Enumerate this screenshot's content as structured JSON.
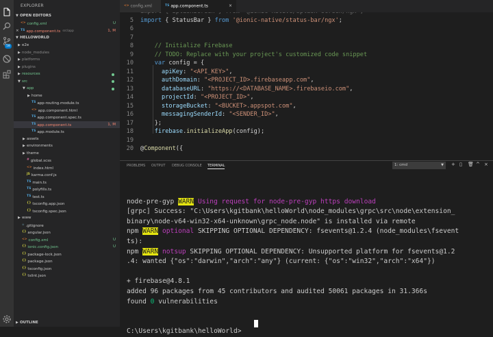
{
  "sidebar": {
    "title": "EXPLORER",
    "open_editors_header": "OPEN EDITORS",
    "open_editors": [
      {
        "name": "config.xml",
        "badge": "U",
        "close": ""
      },
      {
        "name": "app.component.ts",
        "path": "src\\app",
        "badge": "1, M",
        "close": "×"
      }
    ],
    "project_header": "HELLOWORLD",
    "outline_header": "OUTLINE",
    "tree": [
      {
        "label": "e2e",
        "type": "folder",
        "open": false,
        "badge": ""
      },
      {
        "label": "node_modules",
        "type": "folder",
        "open": false,
        "badge": ""
      },
      {
        "label": "platforms",
        "type": "folder",
        "open": false,
        "badge": ""
      },
      {
        "label": "plugins",
        "type": "folder",
        "open": false,
        "badge": ""
      },
      {
        "label": "resources",
        "type": "folder",
        "open": false,
        "badge": "dot"
      },
      {
        "label": "src",
        "type": "folder",
        "open": true,
        "badge": "dot"
      },
      {
        "label": "app",
        "type": "folder",
        "open": true,
        "badge": "dot"
      },
      {
        "label": "home",
        "type": "folder",
        "open": false,
        "badge": ""
      },
      {
        "label": "app-routing.module.ts",
        "type": "ts",
        "badge": ""
      },
      {
        "label": "app.component.html",
        "type": "html",
        "badge": ""
      },
      {
        "label": "app.component.spec.ts",
        "type": "ts",
        "badge": ""
      },
      {
        "label": "app.component.ts",
        "type": "ts",
        "badge": "1, M"
      },
      {
        "label": "app.module.ts",
        "type": "ts",
        "badge": ""
      },
      {
        "label": "assets",
        "type": "folder",
        "open": false,
        "badge": ""
      },
      {
        "label": "environments",
        "type": "folder",
        "open": false,
        "badge": ""
      },
      {
        "label": "theme",
        "type": "folder",
        "open": false,
        "badge": ""
      },
      {
        "label": "global.scss",
        "type": "css",
        "badge": ""
      },
      {
        "label": "index.html",
        "type": "html",
        "badge": ""
      },
      {
        "label": "karma.conf.js",
        "type": "js",
        "badge": ""
      },
      {
        "label": "main.ts",
        "type": "ts",
        "badge": ""
      },
      {
        "label": "polyfills.ts",
        "type": "ts",
        "badge": ""
      },
      {
        "label": "test.ts",
        "type": "ts",
        "badge": ""
      },
      {
        "label": "tsconfig.app.json",
        "type": "json",
        "badge": ""
      },
      {
        "label": "tsconfig.spec.json",
        "type": "json",
        "badge": ""
      },
      {
        "label": "www",
        "type": "folder",
        "open": false,
        "badge": ""
      },
      {
        "label": ".gitignore",
        "type": "git",
        "badge": ""
      },
      {
        "label": "angular.json",
        "type": "json",
        "badge": ""
      },
      {
        "label": "config.xml",
        "type": "xml",
        "badge": "U"
      },
      {
        "label": "ionic.config.json",
        "type": "json",
        "badge": "U"
      },
      {
        "label": "package-lock.json",
        "type": "json",
        "badge": ""
      },
      {
        "label": "package.json",
        "type": "json",
        "badge": ""
      },
      {
        "label": "tsconfig.json",
        "type": "json",
        "badge": ""
      },
      {
        "label": "tslint.json",
        "type": "json",
        "badge": ""
      }
    ]
  },
  "tabs": [
    {
      "label": "config.xml",
      "icon": "xml"
    },
    {
      "label": "app.component.ts",
      "icon": "ts",
      "close": "×"
    }
  ],
  "editor": {
    "lines": [
      {
        "n": "",
        "tokens": [
          [
            "import { SplashScreen } from '@ionic-native/splash-screen/ngx';",
            "#6a6a6a"
          ]
        ]
      },
      {
        "n": "5",
        "tokens": [
          [
            "import",
            "#569cd6"
          ],
          [
            " { StatusBar } ",
            "#d4d4d4"
          ],
          [
            "from",
            "#569cd6"
          ],
          [
            " ",
            "#d4d4d4"
          ],
          [
            "'@ionic-native/status-bar/ngx'",
            "#ce9178"
          ],
          [
            ";",
            "#d4d4d4"
          ]
        ]
      },
      {
        "n": "6",
        "tokens": []
      },
      {
        "n": "7",
        "tokens": []
      },
      {
        "n": "8",
        "tokens": [
          [
            "    // Initialize Firebase",
            "#6a9955"
          ]
        ]
      },
      {
        "n": "9",
        "tokens": [
          [
            "    // TODO: Replace with your project's customized code snippet",
            "#6a9955"
          ]
        ]
      },
      {
        "n": "10",
        "tokens": [
          [
            "    ",
            "#d4d4d4"
          ],
          [
            "var",
            "#569cd6"
          ],
          [
            " config = {",
            "#d4d4d4"
          ]
        ]
      },
      {
        "n": "11",
        "tokens": [
          [
            "      apiKey",
            "#9cdcfe"
          ],
          [
            ": ",
            "#d4d4d4"
          ],
          [
            "\"<API_KEY>\"",
            "#ce9178"
          ],
          [
            ",",
            "#d4d4d4"
          ]
        ]
      },
      {
        "n": "12",
        "tokens": [
          [
            "      authDomain",
            "#9cdcfe"
          ],
          [
            ": ",
            "#d4d4d4"
          ],
          [
            "\"<PROJECT_ID>.firebaseapp.com\"",
            "#ce9178"
          ],
          [
            ",",
            "#d4d4d4"
          ]
        ]
      },
      {
        "n": "13",
        "tokens": [
          [
            "      databaseURL",
            "#9cdcfe"
          ],
          [
            ": ",
            "#d4d4d4"
          ],
          [
            "\"https://<DATABASE_NAME>.firebaseio.com\"",
            "#ce9178"
          ],
          [
            ",",
            "#d4d4d4"
          ]
        ]
      },
      {
        "n": "14",
        "tokens": [
          [
            "      projectId",
            "#9cdcfe"
          ],
          [
            ": ",
            "#d4d4d4"
          ],
          [
            "\"<PROJECT_ID>\"",
            "#ce9178"
          ],
          [
            ",",
            "#d4d4d4"
          ]
        ]
      },
      {
        "n": "15",
        "tokens": [
          [
            "      storageBucket",
            "#9cdcfe"
          ],
          [
            ": ",
            "#d4d4d4"
          ],
          [
            "\"<BUCKET>.appspot.com\"",
            "#ce9178"
          ],
          [
            ",",
            "#d4d4d4"
          ]
        ]
      },
      {
        "n": "16",
        "tokens": [
          [
            "      messagingSenderId",
            "#9cdcfe"
          ],
          [
            ": ",
            "#d4d4d4"
          ],
          [
            "\"<SENDER_ID>\"",
            "#ce9178"
          ],
          [
            ",",
            "#d4d4d4"
          ]
        ]
      },
      {
        "n": "17",
        "tokens": [
          [
            "    };",
            "#d4d4d4"
          ]
        ]
      },
      {
        "n": "18",
        "tokens": [
          [
            "    firebase",
            "#9cdcfe"
          ],
          [
            ".",
            "#d4d4d4"
          ],
          [
            "initializeApp",
            "#dcdcaa"
          ],
          [
            "(config);",
            "#d4d4d4"
          ]
        ]
      },
      {
        "n": "19",
        "tokens": []
      },
      {
        "n": "20",
        "tokens": [
          [
            "@",
            "#d4d4d4"
          ],
          [
            "Component",
            "#dcdcaa"
          ],
          [
            "({",
            "#d4d4d4"
          ]
        ]
      }
    ]
  },
  "panel": {
    "tabs": [
      "PROBLEMS",
      "OUTPUT",
      "DEBUG CONSOLE",
      "TERMINAL"
    ],
    "active_tab": "TERMINAL",
    "terminal_select": "1: cmd",
    "actions": [
      "+",
      "▯",
      "🗑",
      "^",
      "×"
    ],
    "terminal": [
      [],
      [
        [
          "node-pre-gyp ",
          "#cccccc"
        ],
        [
          "WARN",
          "warn"
        ],
        [
          " Using request for node-pre-gyp https download",
          "#bc3fbc"
        ]
      ],
      [
        [
          "[grpc] Success: \"C:\\Users\\kgitbank\\helloWorld\\node_modules\\grpc\\src\\node\\extension_",
          "#cccccc"
        ]
      ],
      [
        [
          "binary\\node-v64-win32-x64-unknown\\grpc_node.node\" is installed via remote",
          "#cccccc"
        ]
      ],
      [
        [
          "npm ",
          "#cccccc"
        ],
        [
          "WARN",
          "warn"
        ],
        [
          " optional",
          "#bc3fbc"
        ],
        [
          " SKIPPING OPTIONAL DEPENDENCY: fsevents@1.2.4 (node_modules\\fsevent",
          "#cccccc"
        ]
      ],
      [
        [
          "ts):",
          "#cccccc"
        ]
      ],
      [
        [
          "npm ",
          "#cccccc"
        ],
        [
          "WARN",
          "warn"
        ],
        [
          " notsup",
          "#bc3fbc"
        ],
        [
          " SKIPPING OPTIONAL DEPENDENCY: Unsupported platform for fsevents@1.2",
          "#cccccc"
        ]
      ],
      [
        [
          ".4: wanted {\"os\":\"darwin\",\"arch\":\"any\"} (current: {\"os\":\"win32\",\"arch\":\"x64\"})",
          "#cccccc"
        ]
      ],
      [],
      [
        [
          "+ firebase@4.8.1",
          "#cccccc"
        ]
      ],
      [
        [
          "added 96 packages from 45 contributors and audited 50061 packages in 31.366s",
          "#cccccc"
        ]
      ],
      [
        [
          "found ",
          "#cccccc"
        ],
        [
          "0",
          "#0dbc79"
        ],
        [
          " vulnerabilities",
          "#cccccc"
        ]
      ],
      [],
      [],
      [
        [
          "C:\\Users\\kgitbank\\helloWorld>",
          "#cccccc"
        ]
      ]
    ]
  },
  "colors": {
    "ts": "#4fa3d8",
    "html": "#e37933",
    "css": "#cc6699",
    "js": "#cbcb41",
    "json": "#cbcb41",
    "xml": "#e37933",
    "git": "#41535b",
    "modified": "#e2c08d",
    "untracked": "#73c991",
    "error": "#f48771"
  }
}
